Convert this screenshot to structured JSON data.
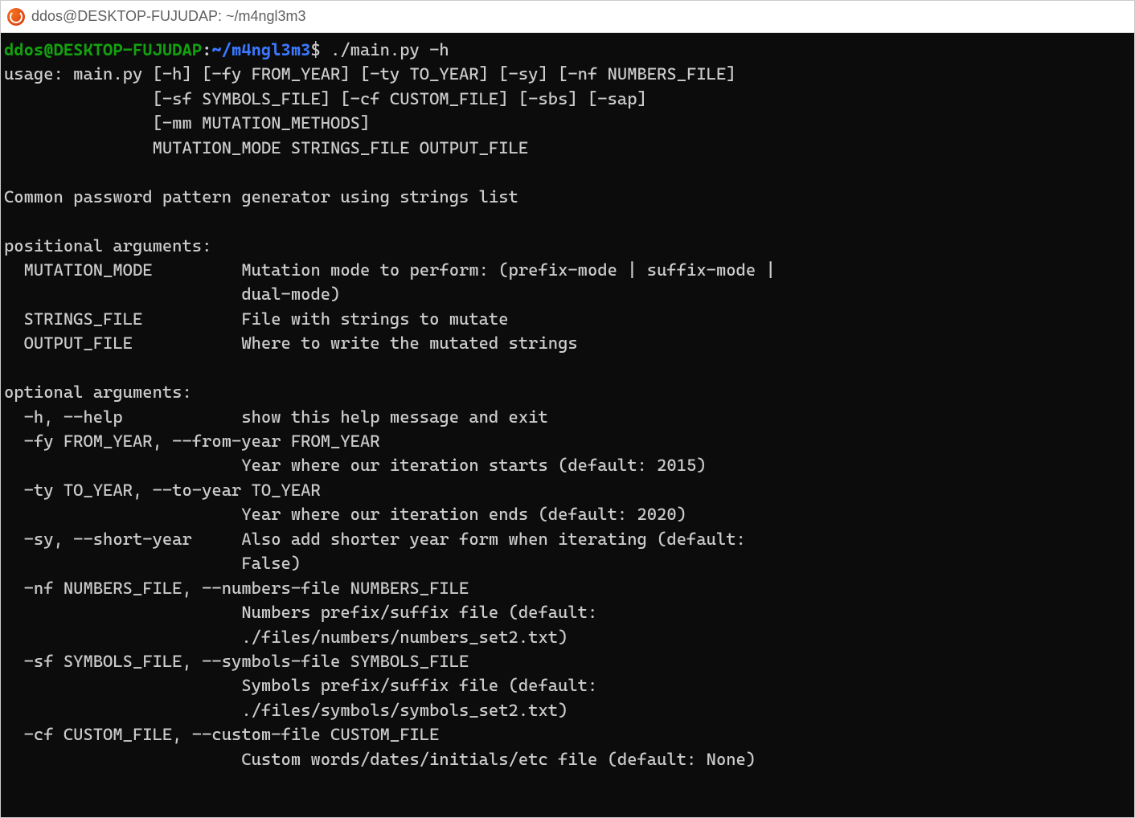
{
  "titlebar": {
    "app_name": "ubuntu",
    "title": "ddos@DESKTOP-FUJUDAP: ~/m4ngl3m3"
  },
  "prompt": {
    "userhost": "ddos@DESKTOP-FUJUDAP",
    "sep": ":",
    "path": "~/m4ngl3m3",
    "dollar": "$ ",
    "command": "./main.py -h"
  },
  "output": {
    "l01": "usage: main.py [-h] [-fy FROM_YEAR] [-ty TO_YEAR] [-sy] [-nf NUMBERS_FILE]",
    "l02": "               [-sf SYMBOLS_FILE] [-cf CUSTOM_FILE] [-sbs] [-sap]",
    "l03": "               [-mm MUTATION_METHODS]",
    "l04": "               MUTATION_MODE STRINGS_FILE OUTPUT_FILE",
    "l05": "",
    "l06": "Common password pattern generator using strings list",
    "l07": "",
    "l08": "positional arguments:",
    "l09": "  MUTATION_MODE         Mutation mode to perform: (prefix-mode | suffix-mode |",
    "l10": "                        dual-mode)",
    "l11": "  STRINGS_FILE          File with strings to mutate",
    "l12": "  OUTPUT_FILE           Where to write the mutated strings",
    "l13": "",
    "l14": "optional arguments:",
    "l15": "  -h, --help            show this help message and exit",
    "l16": "  -fy FROM_YEAR, --from-year FROM_YEAR",
    "l17": "                        Year where our iteration starts (default: 2015)",
    "l18": "  -ty TO_YEAR, --to-year TO_YEAR",
    "l19": "                        Year where our iteration ends (default: 2020)",
    "l20": "  -sy, --short-year     Also add shorter year form when iterating (default:",
    "l21": "                        False)",
    "l22": "  -nf NUMBERS_FILE, --numbers-file NUMBERS_FILE",
    "l23": "                        Numbers prefix/suffix file (default:",
    "l24": "                        ./files/numbers/numbers_set2.txt)",
    "l25": "  -sf SYMBOLS_FILE, --symbols-file SYMBOLS_FILE",
    "l26": "                        Symbols prefix/suffix file (default:",
    "l27": "                        ./files/symbols/symbols_set2.txt)",
    "l28": "  -cf CUSTOM_FILE, --custom-file CUSTOM_FILE",
    "l29": "                        Custom words/dates/initials/etc file (default: None)"
  }
}
